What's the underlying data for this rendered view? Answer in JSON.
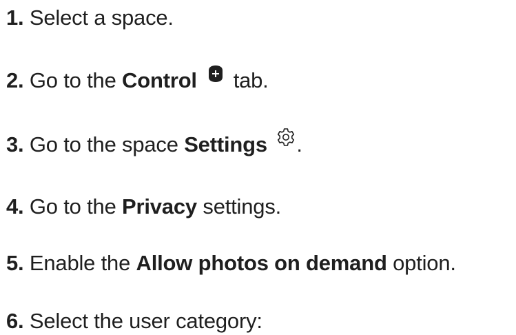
{
  "steps": [
    {
      "num": "1.",
      "text": "Select a space."
    },
    {
      "num": "2.",
      "pre": "Go to the",
      "bold": "Control",
      "icon": "plus-circle-icon",
      "post": "tab."
    },
    {
      "num": "3.",
      "pre": "Go to the space",
      "bold": "Settings",
      "icon": "gear-icon",
      "post": "."
    },
    {
      "num": "4.",
      "pre": "Go to the",
      "bold": "Privacy",
      "post": "settings."
    },
    {
      "num": "5.",
      "pre": "Enable the",
      "bold": "Allow photos on demand",
      "post": "option."
    },
    {
      "num": "6.",
      "text": "Select the user category:"
    }
  ],
  "colors": {
    "text": "#1f1f1f",
    "icon_fill": "#1f1f1f",
    "icon_glyph": "#ffffff"
  }
}
